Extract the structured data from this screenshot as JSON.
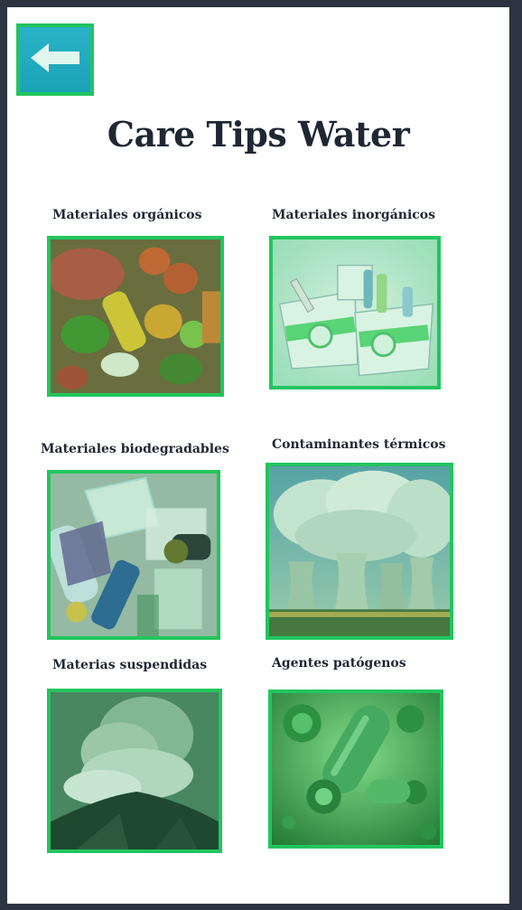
{
  "header": {
    "back_icon": "arrow-left-icon",
    "title": "Care Tips Water"
  },
  "categories": [
    {
      "label": "Materiales orgánicos",
      "image": "organic-food-image"
    },
    {
      "label": "Materiales inorgánicos",
      "image": "recycle-bins-image"
    },
    {
      "label": "Materiales biodegradables",
      "image": "plastic-waste-image"
    },
    {
      "label": "Contaminantes térmicos",
      "image": "cooling-towers-image"
    },
    {
      "label": "Materias suspendidas",
      "image": "volcano-ash-image"
    },
    {
      "label": "Agentes patógenos",
      "image": "bacteria-virus-image"
    }
  ],
  "colors": {
    "frame": "#2b3440",
    "accent_green": "#22c55e",
    "button_teal": "#1fa9bd",
    "title_text": "#1f2733"
  }
}
